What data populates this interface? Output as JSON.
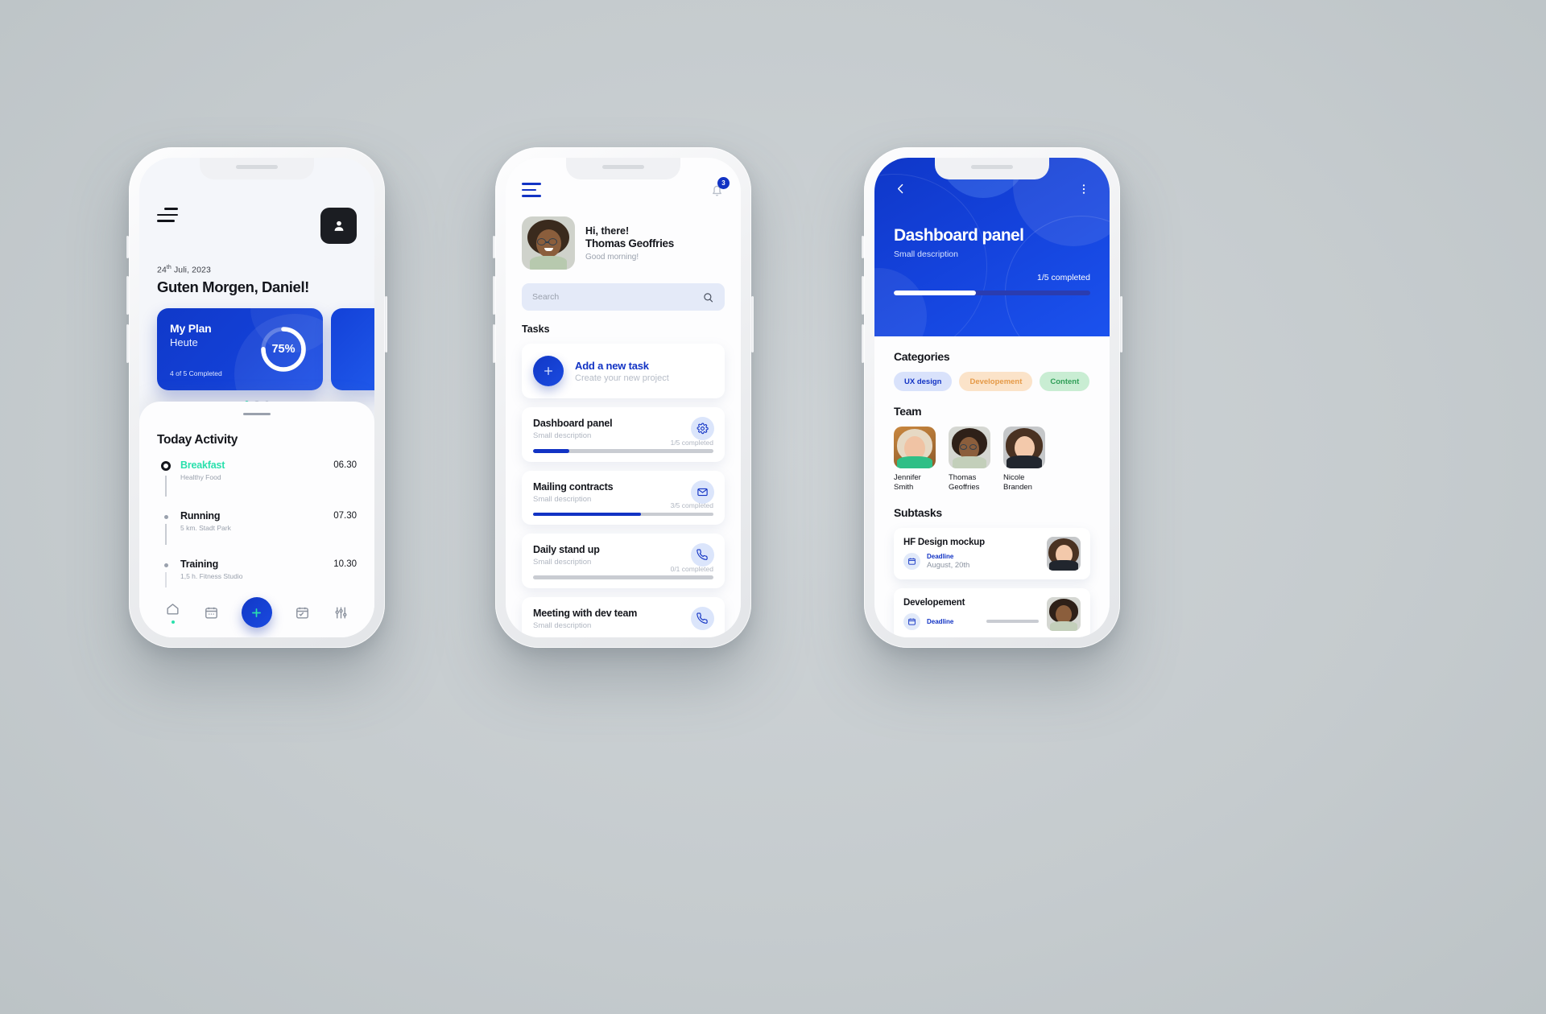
{
  "phone1": {
    "menu_icon": "hamburger-icon",
    "avatar_icon": "user-avatar-icon",
    "date": "24",
    "date_sup": "th",
    "date_rest": " Juli, 2023",
    "greeting": "Guten Morgen, Daniel!",
    "plan_card": {
      "title": "My Plan",
      "subtitle": "Heute",
      "footer": "4 of 5 Completed",
      "percent_label": "75%",
      "percent_value": 75,
      "accent": "#1340d6"
    },
    "carousel_dots": 3,
    "carousel_active_index": 0,
    "section_title": "Today Activity",
    "activities": [
      {
        "name": "Breakfast",
        "desc": "Healthy Food",
        "time": "06.30",
        "active": true
      },
      {
        "name": "Running",
        "desc": "5 km. Stadt Park",
        "time": "07.30",
        "active": false
      },
      {
        "name": "Training",
        "desc": "1,5 h. Fitness Studio",
        "time": "10.30",
        "active": false
      }
    ],
    "nav": [
      {
        "icon": "home-icon",
        "active": true
      },
      {
        "icon": "calendar-icon",
        "active": false
      },
      {
        "icon": "add-plus-fab",
        "active": false
      },
      {
        "icon": "tasks-checklist-icon",
        "active": false
      },
      {
        "icon": "settings-sliders-icon",
        "active": false
      }
    ]
  },
  "phone2": {
    "menu_icon": "hamburger-icon",
    "bell_icon": "notification-bell-icon",
    "notification_count": "3",
    "greeting_line1": "Hi, there!",
    "user_name": "Thomas Geoffries",
    "greeting_line2": "Good morning!",
    "search": {
      "placeholder": "Search",
      "value": "",
      "icon": "search-icon"
    },
    "section_title": "Tasks",
    "add_task": {
      "title": "Add a new task",
      "subtitle": "Create your new project",
      "icon": "plus-icon"
    },
    "tasks": [
      {
        "title": "Dashboard panel",
        "desc": "Small description",
        "completed_label": "1/5 completed",
        "progress": 20,
        "icon": "gear-icon"
      },
      {
        "title": "Mailing contracts",
        "desc": "Small description",
        "completed_label": "3/5 completed",
        "progress": 60,
        "icon": "mail-icon"
      },
      {
        "title": "Daily stand up",
        "desc": "Small description",
        "completed_label": "0/1 completed",
        "progress": 0,
        "icon": "phone-icon"
      },
      {
        "title": "Meeting with dev team",
        "desc": "Small description",
        "completed_label": "",
        "progress": 0,
        "icon": "phone-icon"
      }
    ]
  },
  "phone3": {
    "back_icon": "chevron-left-icon",
    "more_icon": "more-vertical-icon",
    "title": "Dashboard panel",
    "subtitle": "Small description",
    "completed_label": "1/5 completed",
    "progress": 42,
    "categories_title": "Categories",
    "categories": [
      {
        "label": "UX design",
        "bg": "#d9e2fb",
        "fg": "#1233c4"
      },
      {
        "label": "Developement",
        "bg": "#fbe3c9",
        "fg": "#e59a48"
      },
      {
        "label": "Content",
        "bg": "#c9edd3",
        "fg": "#2f9e57"
      }
    ],
    "team_title": "Team",
    "team": [
      {
        "name": "Jennifer Smith"
      },
      {
        "name": "Thomas Geoffries"
      },
      {
        "name": "Nicole Branden"
      }
    ],
    "subtasks_title": "Subtasks",
    "subtasks": [
      {
        "title": "HF Design mockup",
        "deadline_label": "Deadline",
        "date": "August, 20th",
        "icon": "calendar-icon"
      },
      {
        "title": "Developement",
        "deadline_label": "Deadline",
        "date": "",
        "icon": "calendar-icon"
      }
    ]
  }
}
